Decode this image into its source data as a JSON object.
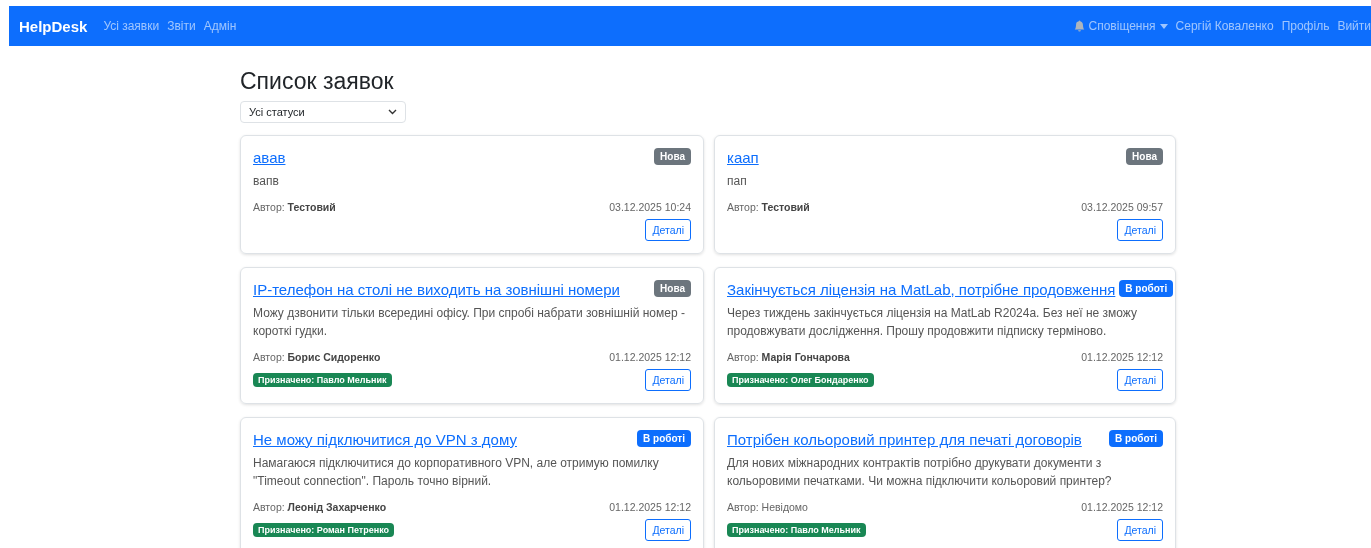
{
  "navbar": {
    "brand": "HelpDesk",
    "links": [
      "Усі заявки",
      "Звіти",
      "Адмін"
    ],
    "notifications": "Сповіщення",
    "user": "Сергій Коваленко",
    "profile": "Профіль",
    "logout": "Вийти"
  },
  "page": {
    "title": "Список заявок",
    "status_filter": "Усі статуси"
  },
  "tickets": [
    {
      "title": "авав",
      "status": {
        "kind": "new",
        "label": "Нова"
      },
      "description": "вапв",
      "author_label": "Автор:",
      "author": "Тестовий",
      "author_known": true,
      "date": "03.12.2025 10:24",
      "details": "Деталі"
    },
    {
      "title": "каап",
      "status": {
        "kind": "new",
        "label": "Нова"
      },
      "description": "пап",
      "author_label": "Автор:",
      "author": "Тестовий",
      "author_known": true,
      "date": "03.12.2025 09:57",
      "details": "Деталі"
    },
    {
      "title": "IP-телефон на столі не виходить на зовнішні номери",
      "status": {
        "kind": "new",
        "label": "Нова"
      },
      "description": "Можу дзвонити тільки всередині офісу. При спробі набрати зовнішній номер - короткі гудки.",
      "author_label": "Автор:",
      "author": "Борис Сидоренко",
      "author_known": true,
      "date": "01.12.2025 12:12",
      "assigned": "Призначено: Павло Мельник",
      "details": "Деталі"
    },
    {
      "title": "Закінчується ліцензія на MatLab, потрібне продовження",
      "status": {
        "kind": "in_progress",
        "label": "В роботі"
      },
      "description": "Через тиждень закінчується ліцензія на MatLab R2024a. Без неї не зможу продовжувати дослідження. Прошу продовжити підписку терміново.",
      "author_label": "Автор:",
      "author": "Марія Гончарова",
      "author_known": true,
      "date": "01.12.2025 12:12",
      "assigned": "Призначено: Олег Бондаренко",
      "details": "Деталі"
    },
    {
      "title": "Не можу підключитися до VPN з дому",
      "status": {
        "kind": "in_progress",
        "label": "В роботі"
      },
      "description": "Намагаюся підключитися до корпоративного VPN, але отримую помилку \"Timeout connection\". Пароль точно вірний.",
      "author_label": "Автор:",
      "author": "Леонід Захарченко",
      "author_known": true,
      "date": "01.12.2025 12:12",
      "assigned": "Призначено: Роман Петренко",
      "details": "Деталі"
    },
    {
      "title": "Потрібен кольоровий принтер для печаті договорів",
      "status": {
        "kind": "in_progress",
        "label": "В роботі"
      },
      "description": "Для нових міжнародних контрактів потрібно друкувати документи з кольоровими печатками. Чи можна підключити кольоровий принтер?",
      "author_label": "Автор:",
      "author": "Невідомо",
      "author_known": false,
      "date": "01.12.2025 12:12",
      "assigned": "Призначено: Павло Мельник",
      "details": "Деталі"
    }
  ]
}
